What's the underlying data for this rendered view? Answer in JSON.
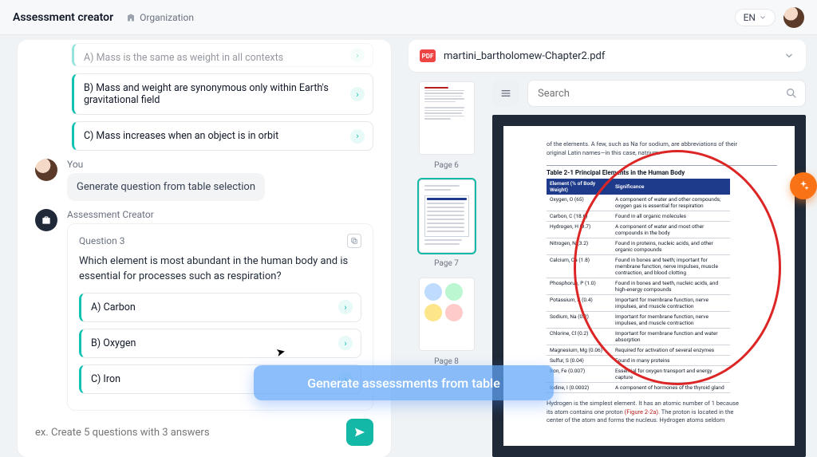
{
  "header": {
    "title": "Assessment creator",
    "org_label": "Organization",
    "lang": "EN"
  },
  "chat": {
    "prev_answers": {
      "a": "A) Mass is the same as weight in all contexts",
      "b": "B) Mass and weight are synonymous only within Earth's gravitational field",
      "c": "C) Mass increases when an object is in orbit"
    },
    "user_name": "You",
    "user_msg": "Generate question from table selection",
    "bot_name": "Assessment Creator",
    "q3": {
      "label": "Question 3",
      "text": "Which element is most abundant in the human body and is essential for processes such as respiration?",
      "a": "A) Carbon",
      "b": "B) Oxygen",
      "c": "C) Iron"
    },
    "input_placeholder": "ex. Create 5 questions with 3 answers"
  },
  "ghost": "Generate assessments from table",
  "file": {
    "badge": "PDF",
    "name": "martini_bartholomew-Chapter2.pdf"
  },
  "search_placeholder": "Search",
  "thumbs": {
    "p6": "Page 6",
    "p7": "Page 7",
    "p8": "Page 8"
  },
  "doc": {
    "intro1": "of the elements. A few, such as Na for sodium, are abbreviations of their",
    "intro2": "original Latin names—in this case, natrium.",
    "table_title": "Table 2-1   Principal Elements in the Human Body",
    "th1": "Element (% of Body Weight)",
    "th2": "Significance",
    "rows": [
      {
        "e": "Oxygen, O (65)",
        "s": "A component of water and other compounds; oxygen gas is essential for respiration"
      },
      {
        "e": "Carbon, C (18.6)",
        "s": "Found in all organic molecules"
      },
      {
        "e": "Hydrogen, H (9.7)",
        "s": "A component of water and most other compounds in the body"
      },
      {
        "e": "Nitrogen, N (3.2)",
        "s": "Found in proteins, nucleic acids, and other organic compounds"
      },
      {
        "e": "Calcium, Ca (1.8)",
        "s": "Found in bones and teeth; important for membrane function, nerve impulses, muscle contraction, and blood clotting"
      },
      {
        "e": "Phosphorus, P (1.0)",
        "s": "Found in bones and teeth, nucleic acids, and high-energy compounds"
      },
      {
        "e": "Potassium, K (0.4)",
        "s": "Important for membrane function, nerve impulses, and muscle contraction"
      },
      {
        "e": "Sodium, Na (0.2)",
        "s": "Important for membrane function, nerve impulses, and muscle contraction"
      },
      {
        "e": "Chlorine, Cl (0.2)",
        "s": "Important for membrane function and water absorption"
      },
      {
        "e": "Magnesium, Mg (0.06)",
        "s": "Required for activation of several enzymes"
      },
      {
        "e": "Sulfur, S (0.04)",
        "s": "Found in many proteins"
      },
      {
        "e": "Iron, Fe (0.007)",
        "s": "Essential for oxygen transport and energy capture"
      },
      {
        "e": "Iodine, I (0.0002)",
        "s": "A component of hormones of the thyroid gland"
      }
    ],
    "out1": "Hydrogen is the simplest element. It has an atomic number of 1 because",
    "out2_a": "its atom contains one proton ",
    "out2_link": "(Figure 2-2a)",
    "out2_b": ". The proton is located in the",
    "out3": "center of the atom and forms the nucleus. Hydrogen atoms seldom"
  },
  "chart_data": {
    "type": "table",
    "title": "Table 2-1 Principal Elements in the Human Body",
    "columns": [
      "Element (% of Body Weight)",
      "Significance"
    ],
    "rows": [
      [
        "Oxygen, O (65)",
        "A component of water and other compounds; oxygen gas is essential for respiration"
      ],
      [
        "Carbon, C (18.6)",
        "Found in all organic molecules"
      ],
      [
        "Hydrogen, H (9.7)",
        "A component of water and most other compounds in the body"
      ],
      [
        "Nitrogen, N (3.2)",
        "Found in proteins, nucleic acids, and other organic compounds"
      ],
      [
        "Calcium, Ca (1.8)",
        "Found in bones and teeth; important for membrane function, nerve impulses, muscle contraction, and blood clotting"
      ],
      [
        "Phosphorus, P (1.0)",
        "Found in bones and teeth, nucleic acids, and high-energy compounds"
      ],
      [
        "Potassium, K (0.4)",
        "Important for membrane function, nerve impulses, and muscle contraction"
      ],
      [
        "Sodium, Na (0.2)",
        "Important for membrane function, nerve impulses, and muscle contraction"
      ],
      [
        "Chlorine, Cl (0.2)",
        "Important for membrane function and water absorption"
      ],
      [
        "Magnesium, Mg (0.06)",
        "Required for activation of several enzymes"
      ],
      [
        "Sulfur, S (0.04)",
        "Found in many proteins"
      ],
      [
        "Iron, Fe (0.007)",
        "Essential for oxygen transport and energy capture"
      ],
      [
        "Iodine, I (0.0002)",
        "A component of hormones of the thyroid gland"
      ]
    ]
  }
}
